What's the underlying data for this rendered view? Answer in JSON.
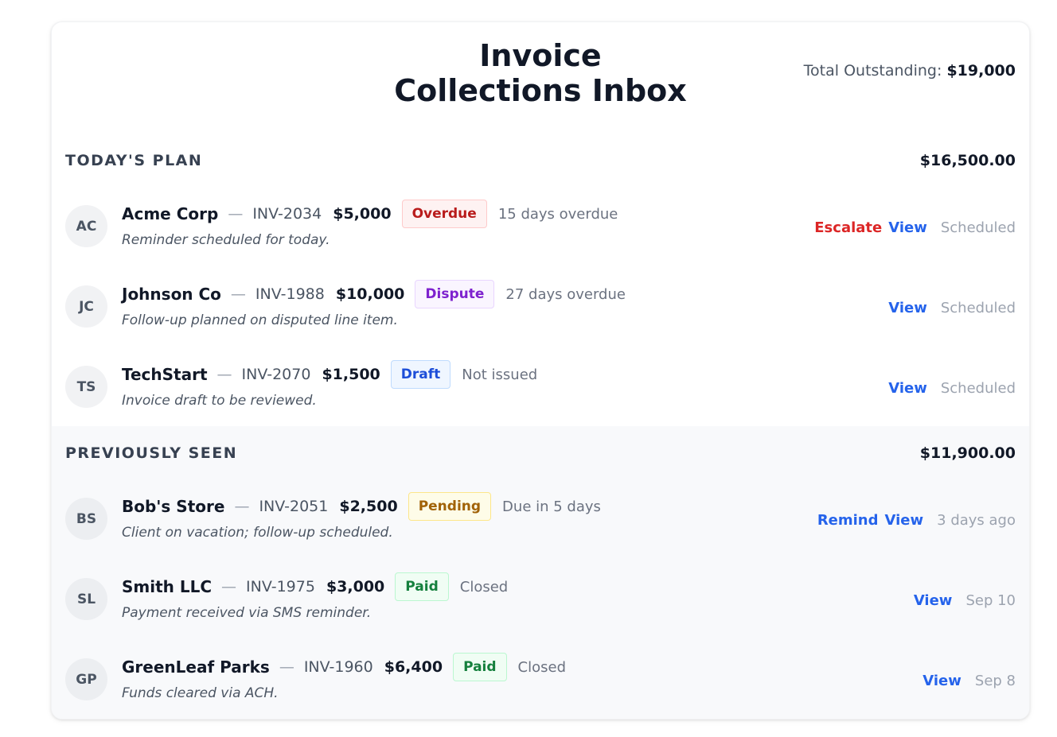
{
  "header": {
    "title_line1": "Invoice",
    "title_line2": "Collections Inbox",
    "total_label": "Total Outstanding:",
    "total_value": "$19,000"
  },
  "today": {
    "title": "TODAY'S PLAN",
    "sum": "$16,500.00",
    "rows": [
      {
        "initials": "AC",
        "client": "Acme Corp",
        "dash": "—",
        "invoice": "INV-2034",
        "amount": "$5,000",
        "badge": "Overdue",
        "status": "15 days overdue",
        "note": "Reminder scheduled for today.",
        "action1": "Escalate",
        "view": "View",
        "when": "Scheduled"
      },
      {
        "initials": "JC",
        "client": "Johnson Co",
        "dash": "—",
        "invoice": "INV-1988",
        "amount": "$10,000",
        "badge": "Dispute",
        "status": "27 days overdue",
        "note": "Follow-up planned on disputed line item.",
        "view": "View",
        "when": "Scheduled"
      },
      {
        "initials": "TS",
        "client": "TechStart",
        "dash": "—",
        "invoice": "INV-2070",
        "amount": "$1,500",
        "badge": "Draft",
        "status": "Not issued",
        "note": "Invoice draft to be reviewed.",
        "view": "View",
        "when": "Scheduled"
      }
    ]
  },
  "previous": {
    "title": "PREVIOUSLY SEEN",
    "sum": "$11,900.00",
    "rows": [
      {
        "initials": "BS",
        "client": "Bob's Store",
        "dash": "—",
        "invoice": "INV-2051",
        "amount": "$2,500",
        "badge": "Pending",
        "status": "Due in 5 days",
        "note": "Client on vacation; follow-up scheduled.",
        "action1": "Remind",
        "view": "View",
        "when": "3 days ago"
      },
      {
        "initials": "SL",
        "client": "Smith LLC",
        "dash": "—",
        "invoice": "INV-1975",
        "amount": "$3,000",
        "badge": "Paid",
        "status": "Closed",
        "note": "Payment received via SMS reminder.",
        "view": "View",
        "when": "Sep 10"
      },
      {
        "initials": "GP",
        "client": "GreenLeaf Parks",
        "dash": "—",
        "invoice": "INV-1960",
        "amount": "$6,400",
        "badge": "Paid",
        "status": "Closed",
        "note": "Funds cleared via ACH.",
        "view": "View",
        "when": "Sep 8"
      }
    ]
  }
}
